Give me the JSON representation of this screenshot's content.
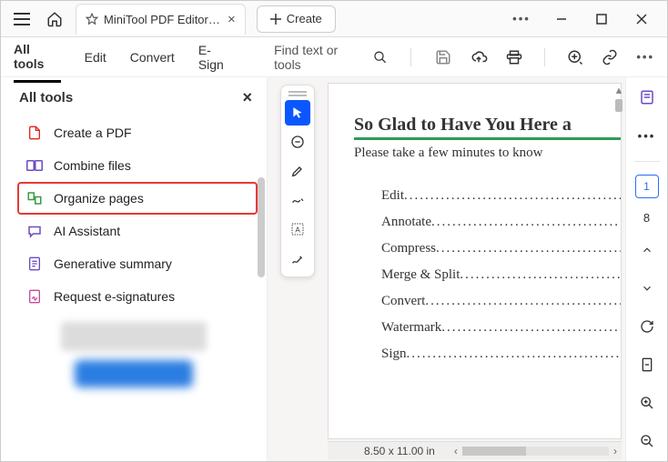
{
  "titlebar": {
    "tab_title": "MiniTool PDF Editor Use...",
    "create_label": "Create"
  },
  "topnav": {
    "all_tools": "All tools",
    "edit": "Edit",
    "convert": "Convert",
    "esign": "E-Sign",
    "find_placeholder": "Find text or tools"
  },
  "sidebar": {
    "heading": "All tools",
    "items": [
      {
        "label": "Create a PDF"
      },
      {
        "label": "Combine files"
      },
      {
        "label": "Organize pages"
      },
      {
        "label": "AI Assistant"
      },
      {
        "label": "Generative summary"
      },
      {
        "label": "Request e-signatures"
      }
    ]
  },
  "document": {
    "title": "So Glad to Have You Here a",
    "subtitle": "Please take a few minutes to know",
    "toc": [
      "Edit",
      "Annotate",
      "Compress",
      "Merge & Split",
      "Convert",
      "Watermark",
      "Sign"
    ],
    "page_size": "8.50 x 11.00 in"
  },
  "rightrail": {
    "current_page": "1",
    "total_pages": "8"
  }
}
